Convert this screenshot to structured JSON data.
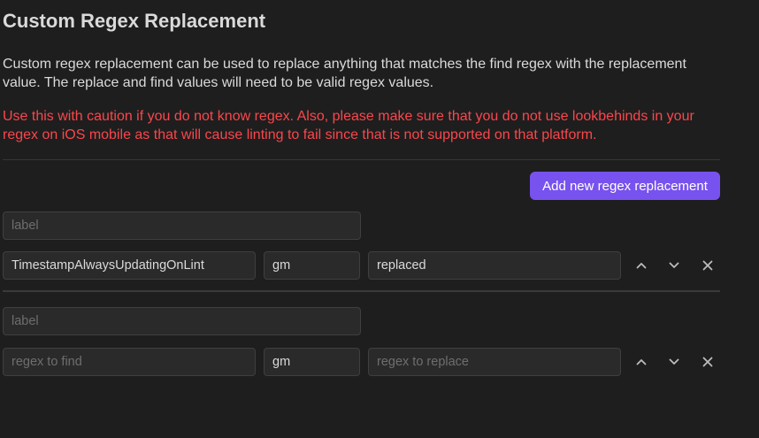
{
  "section": {
    "title": "Custom Regex Replacement",
    "description": "Custom regex replacement can be used to replace anything that matches the find regex with the replacement value. The replace and find values will need to be valid regex values.",
    "warning": "Use this with caution if you do not know regex. Also, please make sure that you do not use lookbehinds in your regex on iOS mobile as that will cause linting to fail since that is not supported on that platform."
  },
  "add_button_label": "Add new regex replacement",
  "placeholders": {
    "label": "label",
    "find": "regex to find",
    "replace": "regex to replace"
  },
  "rules": [
    {
      "label": "",
      "find": "TimestampAlwaysUpdatingOnLint",
      "flags": "gm",
      "replace": "replaced"
    },
    {
      "label": "",
      "find": "",
      "flags": "gm",
      "replace": ""
    }
  ],
  "icons": [
    "chevron-up-icon",
    "chevron-down-icon",
    "close-icon"
  ],
  "colors": {
    "background": "#1e1e1e",
    "text": "#dadada",
    "warning": "#fb464c",
    "accent": "#7852ee",
    "input_bg": "#2a2a2a"
  }
}
